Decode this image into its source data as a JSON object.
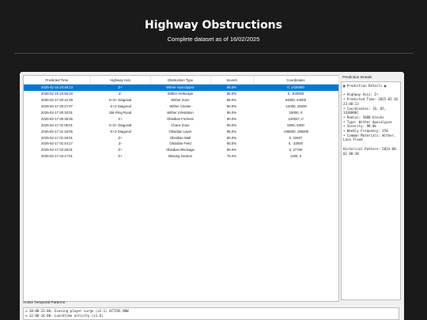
{
  "header": {
    "title": "Highway Obstructions",
    "subtitle": "Complete dataset as of 16/02/2025"
  },
  "table": {
    "columns": [
      "Predicted Time",
      "Highway Axis",
      "Obstruction Type",
      "Severit",
      "Coordinates"
    ],
    "rows": [
      [
        "2025-02-16 23:48:13",
        "Z+",
        "Wither Apocalypse",
        "98.0%",
        "0, 1430000"
      ],
      [
        "2025-02-16 23:56:33",
        "Z-",
        "Wither Hellscape",
        "95.0%",
        "0, -930000"
      ],
      [
        "2025-02-17 00:12:39",
        "X+Z+ Diagonal",
        "Wither Zone",
        "88.0%",
        "64000, 64000"
      ],
      [
        "2025-02-17 00:27:07",
        "-X+Z Diagonal",
        "Wither Cluster",
        "90.0%",
        "-12000, 25000"
      ],
      [
        "2025-02-17 00:33:01",
        "15k Ring Road",
        "Wither Infestation",
        "85.0%",
        "15000, 0"
      ],
      [
        "2025-02-17 00:38:36",
        "X+",
        "Obsidian Fortress",
        "90.0%",
        "120027, 0"
      ],
      [
        "2025-02-17 01:05:01",
        "X+Z+ Diagonal",
        "Chaos Zone",
        "80.0%",
        "6000, 6000"
      ],
      [
        "2025-02-17 01:16:05",
        "-X+Z Diagonal",
        "Obsidian Layer",
        "85.0%",
        "-196000, 196000"
      ],
      [
        "2025-02-17 01:29:01",
        "Z+",
        "Obsidian Wall",
        "85.0%",
        "0, 32607"
      ],
      [
        "2025-02-17 01:44:17",
        "Z-",
        "Obsidian Field",
        "80.0%",
        "0, -33000"
      ],
      [
        "2025-02-17 02:25:01",
        "Z+",
        "Obsidian Blockage",
        "80.0%",
        "0, 27700"
      ],
      [
        "2025-02-17 04:17:01",
        "X+",
        "Missing Section",
        "75.0%",
        "1400, 0"
      ]
    ]
  },
  "details": {
    "label": "Prediction Details",
    "lines": [
      "▦ Prediction Details ▦",
      "",
      "• Highway Axis: Z+",
      "• Predicted Time: 2025-02-16 23:48:13",
      "• Coordinates: [0, 65, 1430000]",
      "• Radius: 5000 blocks",
      "• Type: Wither Apocalypse",
      "• Severity: 98.0%",
      "• Weekly Frequency: 150",
      "• Common Materials: Wither, Lava Flood",
      "",
      "Historical Pattern: 2024-08-02 08:30"
    ]
  },
  "patterns": {
    "label": "Active Temporal Patterns",
    "lines": [
      "⊙ 18:00-23:00: Evening player surge (x2.1) ACTIVE NOW",
      "⊙ 12:00-14:00: Lunchtime activity (x1.6)"
    ]
  }
}
